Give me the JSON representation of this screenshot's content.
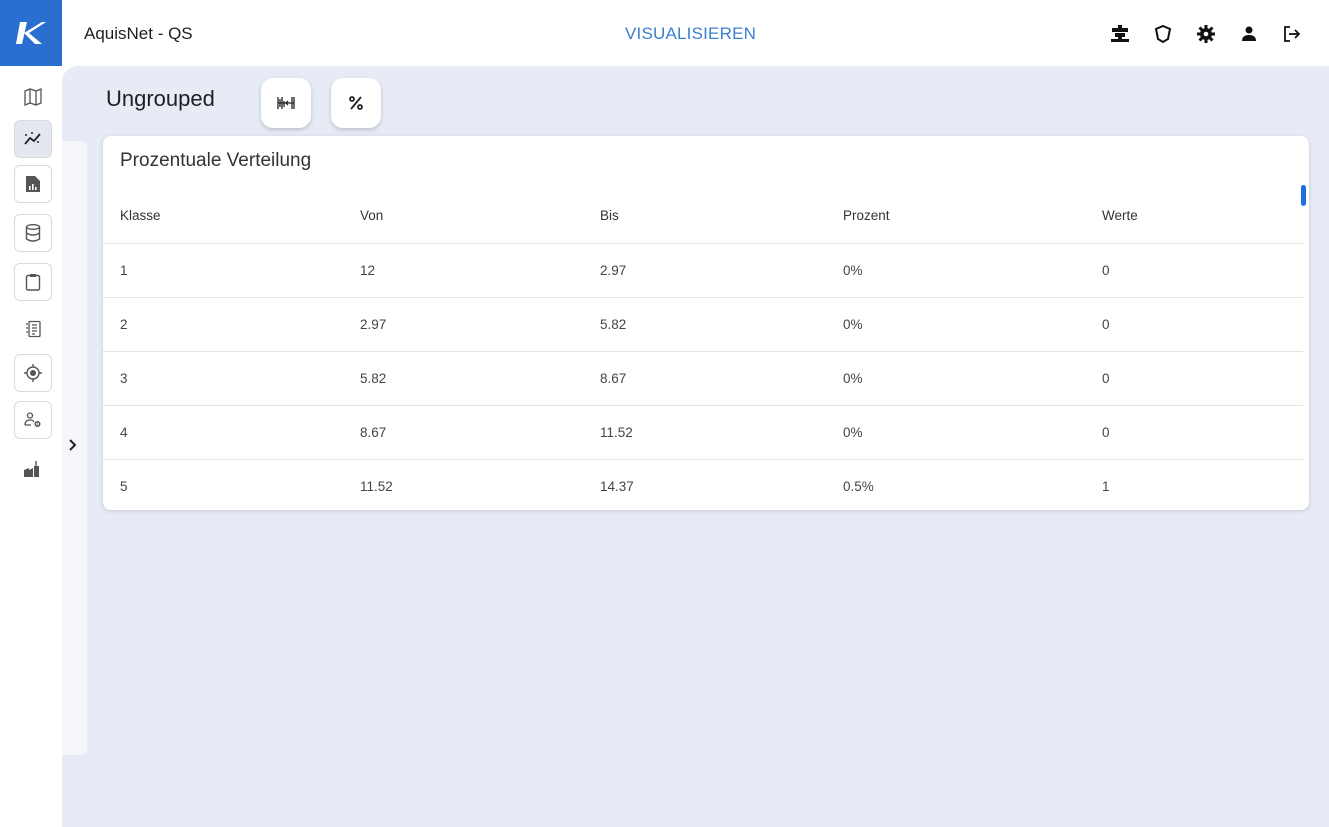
{
  "header": {
    "app_title": "AquisNet - QS",
    "nav_title": "VISUALISIEREN",
    "icons": [
      "machine-icon",
      "shield-icon",
      "gear-icon",
      "user-icon",
      "logout-icon"
    ]
  },
  "rail": {
    "items": [
      "map-icon",
      "visualize-icon",
      "report-icon",
      "database-icon",
      "clipboard-icon",
      "document-list-icon",
      "target-icon",
      "user-settings-icon",
      "factory-icon"
    ],
    "active": "visualize-icon"
  },
  "main": {
    "group_title": "Ungrouped",
    "tool_buttons": [
      "histogram-icon",
      "percent-icon"
    ]
  },
  "card": {
    "title": "Prozentuale Verteilung",
    "columns": [
      "Klasse",
      "Von",
      "Bis",
      "Prozent",
      "Werte"
    ],
    "rows": [
      [
        "1",
        "12",
        "2.97",
        "0%",
        "0"
      ],
      [
        "2",
        "2.97",
        "5.82",
        "0%",
        "0"
      ],
      [
        "3",
        "5.82",
        "8.67",
        "0%",
        "0"
      ],
      [
        "4",
        "8.67",
        "11.52",
        "0%",
        "0"
      ],
      [
        "5",
        "11.52",
        "14.37",
        "0.5%",
        "1"
      ]
    ]
  },
  "colors": {
    "accent": "#3b7fd0",
    "logo_bg": "#2a6fcf",
    "main_bg": "#e6ebf5",
    "scroll": "#1f6fe0"
  }
}
